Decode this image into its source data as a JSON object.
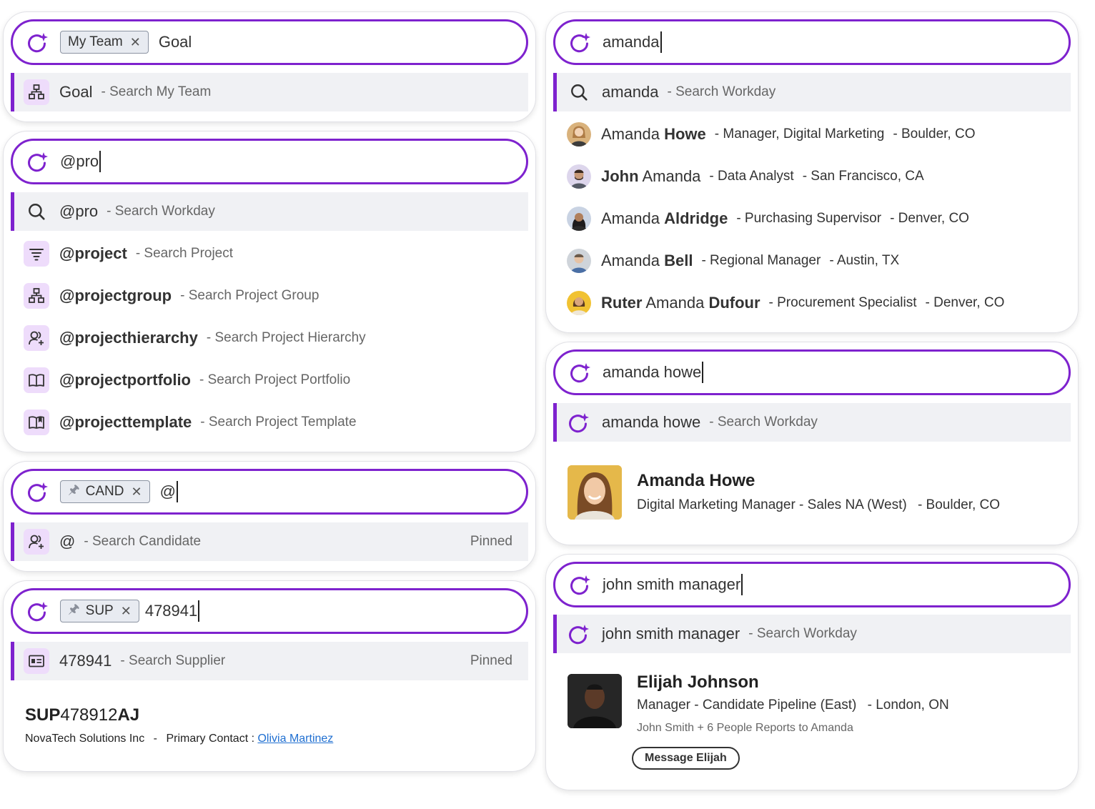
{
  "colors": {
    "accent": "#7e22ce",
    "icon_bg": "#eedcfb",
    "row_highlight": "#f0f1f4",
    "link": "#1f6fd1"
  },
  "panel1": {
    "chip": "My Team",
    "query": "Goal",
    "result": {
      "main": "Goal",
      "sub": "- Search My Team",
      "icon": "org-chart-icon"
    }
  },
  "panel2": {
    "query": "@pro",
    "results": [
      {
        "main": "@pro",
        "sub": "- Search Workday",
        "icon": "search-icon"
      },
      {
        "main": "@project",
        "sub": "- Search Project",
        "icon": "filter-list-icon"
      },
      {
        "main": "@projectgroup",
        "sub": "- Search Project Group",
        "icon": "org-chart-icon"
      },
      {
        "main": "@projecthierarchy",
        "sub": "- Search Project Hierarchy",
        "icon": "users-add-icon"
      },
      {
        "main": "@projectportfolio",
        "sub": "- Search Project Portfolio",
        "icon": "book-icon"
      },
      {
        "main": "@projecttemplate",
        "sub": "- Search Project Template",
        "icon": "bookmark-book-icon"
      }
    ]
  },
  "panel3": {
    "chip": "CAND",
    "query": "@",
    "result": {
      "main": "@",
      "sub": "- Search Candidate",
      "pinned": "Pinned",
      "icon": "users-add-icon"
    }
  },
  "panel4": {
    "chip": "SUP",
    "query": "478941",
    "result": {
      "main": "478941",
      "sub": "- Search Supplier",
      "pinned": "Pinned",
      "icon": "id-card-icon"
    },
    "detail": {
      "id_prefix": "SUP",
      "id_number": "478912",
      "id_suffix": "AJ",
      "company": "NovaTech Solutions Inc",
      "sep": "-",
      "contact_label": "Primary Contact :",
      "contact_name": "Olivia Martinez"
    }
  },
  "panel5": {
    "query": "amanda",
    "search_row": {
      "main": "amanda",
      "sub": "- Search Workday"
    },
    "people": [
      {
        "first": "Amanda",
        "last": "Howe",
        "first_bold": false,
        "last_bold": true,
        "middle": "",
        "role": "- Manager, Digital Marketing",
        "location": "- Boulder, CO"
      },
      {
        "first": "John",
        "last": "Amanda",
        "first_bold": true,
        "last_bold": false,
        "middle": "",
        "role": "- Data Analyst",
        "location": "- San Francisco, CA"
      },
      {
        "first": "Amanda",
        "last": "Aldridge",
        "first_bold": false,
        "last_bold": true,
        "middle": "",
        "role": "- Purchasing Supervisor",
        "location": "- Denver, CO"
      },
      {
        "first": "Amanda",
        "last": "Bell",
        "first_bold": false,
        "last_bold": true,
        "middle": "",
        "role": "- Regional Manager",
        "location": "- Austin, TX"
      },
      {
        "first": "Ruter",
        "middle": "Amanda",
        "last": "Dufour",
        "first_bold": true,
        "last_bold": true,
        "role": "- Procurement Specialist",
        "location": "- Denver, CO"
      }
    ]
  },
  "panel6": {
    "query": "amanda howe",
    "search_row": {
      "main": "amanda howe",
      "sub": "- Search Workday"
    },
    "detail": {
      "name": "Amanda Howe",
      "title": "Digital Marketing Manager - Sales NA (West)",
      "location": "- Boulder, CO"
    }
  },
  "panel7": {
    "query": "john smith manager",
    "search_row": {
      "main": "john smith manager",
      "sub": "- Search Workday"
    },
    "detail": {
      "name": "Elijah Johnson",
      "title": "Manager - Candidate Pipeline (East)",
      "location": "- London, ON",
      "relation": "John Smith + 6 People Reports to Amanda",
      "button": "Message Elijah"
    }
  }
}
